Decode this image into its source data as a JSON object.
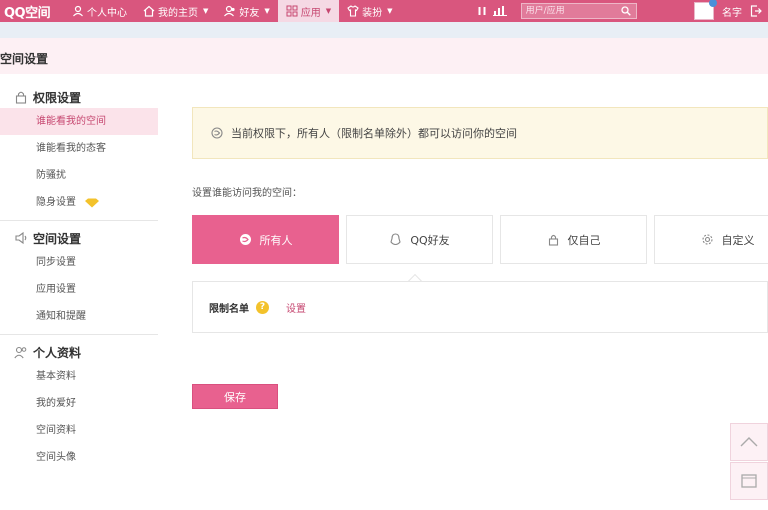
{
  "topbar": {
    "brand": "QQ空间",
    "nav": [
      {
        "label": "个人中心",
        "icon": "person-icon"
      },
      {
        "label": "我的主页",
        "icon": "home-icon"
      },
      {
        "label": "好友",
        "icon": "friends-icon"
      },
      {
        "label": "应用",
        "icon": "apps-grid-icon"
      },
      {
        "label": "装扮",
        "icon": "shirt-icon"
      }
    ],
    "search_placeholder": "用户/应用",
    "username": "名字"
  },
  "page_title": "空间设置",
  "sidebar": {
    "sections": [
      {
        "title": "权限设置",
        "icon": "lock-icon",
        "items": [
          "谁能看我的空间",
          "谁能看我的态客",
          "防骚扰",
          "隐身设置"
        ]
      },
      {
        "title": "空间设置",
        "icon": "speaker-icon",
        "items": [
          "同步设置",
          "应用设置",
          "通知和提醒"
        ]
      },
      {
        "title": "个人资料",
        "icon": "users-icon",
        "items": [
          "基本资料",
          "我的爱好",
          "空间资料",
          "空间头像"
        ]
      }
    ]
  },
  "main": {
    "notice": "当前权限下，所有人（限制名单除外）都可以访问你的空间",
    "set_label": "设置谁能访问我的空间：",
    "options": [
      {
        "label": "所有人",
        "icon": "globe-icon",
        "selected": true
      },
      {
        "label": "QQ好友",
        "icon": "qq-penguin-icon",
        "selected": false
      },
      {
        "label": "仅自己",
        "icon": "lock-icon",
        "selected": false
      },
      {
        "label": "自定义",
        "icon": "gear-icon",
        "selected": false
      }
    ],
    "blacklist_label": "限制名单",
    "help_mark": "?",
    "set_link": "设置",
    "save_label": "保存"
  },
  "colors": {
    "brand_pink": "#d9567e",
    "accent": "#e8618f",
    "notice_bg": "#fdf8e6"
  }
}
